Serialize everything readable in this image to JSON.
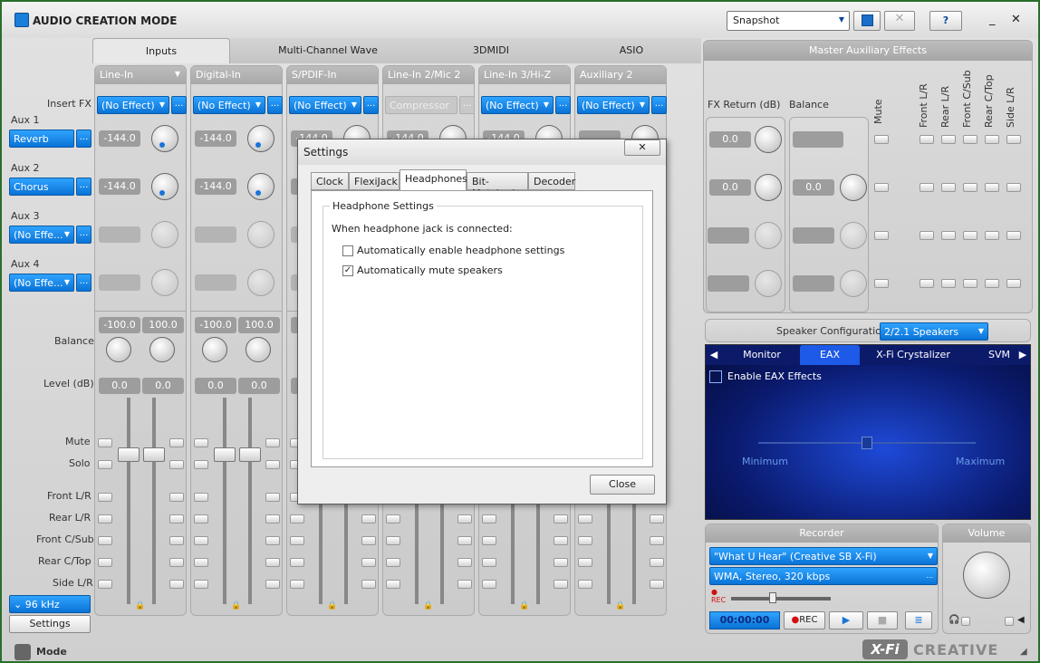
{
  "app": {
    "title": "AUDIO CREATION MODE",
    "snapshot_label": "Snapshot",
    "help_label": "?",
    "minimize": "_",
    "close": "✕"
  },
  "main_tabs": [
    "Inputs",
    "Multi-Channel Wave",
    "3DMIDI",
    "ASIO"
  ],
  "row_labels": {
    "insert_fx": "Insert FX",
    "aux1": "Aux 1",
    "aux2": "Aux 2",
    "aux3": "Aux 3",
    "aux4": "Aux 4",
    "balance": "Balance",
    "level": "Level (dB)",
    "mute": "Mute",
    "solo": "Solo",
    "front_lr": "Front L/R",
    "rear_lr": "Rear L/R",
    "front_csub": "Front C/Sub",
    "rear_ctop": "Rear C/Top",
    "side_lr": "Side L/R"
  },
  "aux_effects": {
    "aux1": "Reverb",
    "aux2": "Chorus",
    "aux3": "(No Effe...",
    "aux4": "(No Effe..."
  },
  "sample_rate": "96 kHz",
  "settings_label": "Settings",
  "mode_label": "Mode",
  "strips": [
    {
      "name": "Line-In",
      "fx": "(No Effect)",
      "aux1": "-144.0",
      "aux2": "-144.0",
      "bal_l": "-100.0",
      "bal_r": "100.0",
      "level_l": "0.0",
      "level_r": "0.0"
    },
    {
      "name": "Digital-In",
      "fx": "(No Effect)",
      "aux1": "-144.0",
      "aux2": "-144.0",
      "bal_l": "-100.0",
      "bal_r": "100.0",
      "level_l": "0.0",
      "level_r": "0.0"
    },
    {
      "name": "S/PDIF-In",
      "fx": "(No Effect)",
      "aux1": "-144.0",
      "aux2": "",
      "bal_l": "",
      "bal_r": "",
      "level_l": "",
      "level_r": ""
    },
    {
      "name": "Line-In 2/Mic 2",
      "fx": "Compressor",
      "aux1": "-144.0",
      "aux2": "",
      "bal_l": "",
      "bal_r": "",
      "level_l": "",
      "level_r": ""
    },
    {
      "name": "Line-In 3/Hi-Z",
      "fx": "(No Effect)",
      "aux1": "-144.0",
      "aux2": "",
      "bal_l": "",
      "bal_r": "",
      "level_l": "",
      "level_r": ""
    },
    {
      "name": "Auxiliary 2",
      "fx": "(No Effect)",
      "aux1": "",
      "aux2": "",
      "bal_l": "",
      "bal_r": "",
      "level_l": "",
      "level_r": ""
    }
  ],
  "master": {
    "title": "Master Auxiliary Effects",
    "fx_return_label": "FX Return (dB)",
    "balance_label": "Balance",
    "fx_return_values": [
      "0.0",
      "0.0"
    ],
    "balance_value": "0.0",
    "col_headers": [
      "Mute",
      "Front L/R",
      "Rear L/R",
      "Front C/Sub",
      "Rear C/Top",
      "Side L/R"
    ]
  },
  "speaker": {
    "label": "Speaker Configuration:",
    "value": "2/2.1 Speakers"
  },
  "eax_tabs": [
    "Monitor",
    "EAX",
    "X-Fi Crystalizer",
    "SVM"
  ],
  "eax": {
    "enable_label": "Enable EAX Effects",
    "min_label": "Minimum",
    "max_label": "Maximum"
  },
  "recorder": {
    "title": "Recorder",
    "source": "\"What U Hear\" (Creative SB X-Fi)",
    "format": "WMA, Stereo, 320 kbps",
    "time": "00:00:00",
    "rec_label": "REC",
    "rec_small": "REC"
  },
  "volume": {
    "title": "Volume"
  },
  "brand": {
    "xfi": "X-Fi",
    "creative": "CREATIVE"
  },
  "dialog": {
    "title": "Settings",
    "tabs": [
      "Clock",
      "FlexiJack",
      "Headphones",
      "Bit-Matched",
      "Decoder"
    ],
    "group_title": "Headphone Settings",
    "prompt": "When headphone jack is connected:",
    "options": [
      {
        "label": "Automatically enable headphone settings",
        "checked": false
      },
      {
        "label": "Automatically mute speakers",
        "checked": true
      }
    ],
    "close_label": "Close"
  },
  "colors": {
    "accent_blue": "#0a73d6",
    "eax_bg": "#0a1e8c",
    "rec_red": "#d01010"
  }
}
